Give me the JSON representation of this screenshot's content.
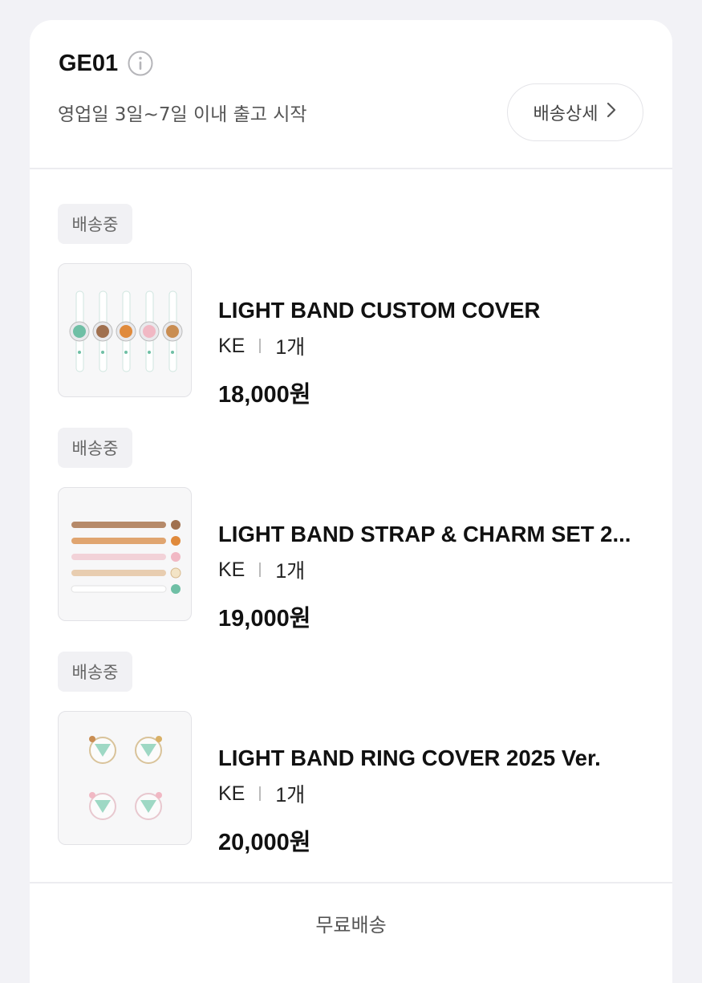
{
  "shipment": {
    "code": "GE01",
    "subtitle": "영업일 3일~7일 이내 출고 시작",
    "detail_button": "배송상세"
  },
  "items": [
    {
      "status": "배송중",
      "name": "LIGHT BAND CUSTOM COVER",
      "option": "KE",
      "qty": "1개",
      "price": "18,000원"
    },
    {
      "status": "배송중",
      "name": "LIGHT BAND STRAP & CHARM SET 2...",
      "option": "KE",
      "qty": "1개",
      "price": "19,000원"
    },
    {
      "status": "배송중",
      "name": "LIGHT BAND RING COVER 2025 Ver.",
      "option": "KE",
      "qty": "1개",
      "price": "20,000원"
    }
  ],
  "footer": {
    "shipping_fee": "무료배송"
  },
  "icons": {
    "info": "info-icon",
    "chevron": "chevron-right-icon"
  },
  "colors": {
    "background": "#f2f2f6",
    "card": "#ffffff",
    "badge_bg": "#f1f1f4",
    "strap_colors": [
      "#b68a6a",
      "#e0a570",
      "#f2d2d8",
      "#e8cdb0",
      "#ffffff"
    ]
  }
}
